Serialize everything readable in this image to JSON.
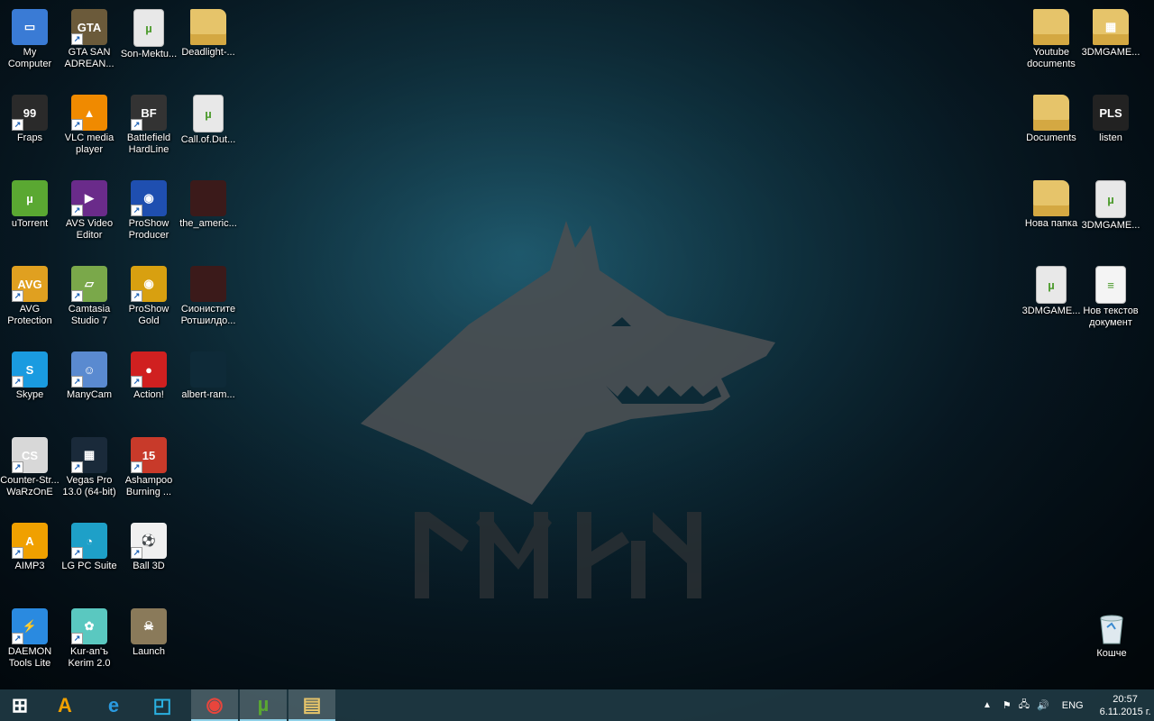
{
  "desktop_left": [
    {
      "label": "My Computer",
      "icon": "computer-icon",
      "color": "#3a7bd5",
      "glyph": "▭",
      "shortcut": false,
      "col": 0,
      "row": 0
    },
    {
      "label": "GTA SAN ADREAN...",
      "icon": "gta-icon",
      "color": "#6b5a3a",
      "glyph": "GTA",
      "shortcut": true,
      "col": 1,
      "row": 0
    },
    {
      "label": "Son-Mektu...",
      "icon": "torrent-file-icon",
      "color": "#e8e8e8",
      "glyph": "µ",
      "shortcut": false,
      "col": 2,
      "row": 0
    },
    {
      "label": "Deadlight-...",
      "icon": "folder-icon",
      "color": "#e6c46a",
      "glyph": "",
      "shortcut": false,
      "col": 3,
      "row": 0
    },
    {
      "label": "Fraps",
      "icon": "fraps-icon",
      "color": "#2a2a2a",
      "glyph": "99",
      "shortcut": true,
      "col": 0,
      "row": 1
    },
    {
      "label": "VLC media player",
      "icon": "vlc-icon",
      "color": "#f08a00",
      "glyph": "▲",
      "shortcut": true,
      "col": 1,
      "row": 1
    },
    {
      "label": "Battlefield HardLine",
      "icon": "battlefield-icon",
      "color": "#333",
      "glyph": "BF",
      "shortcut": true,
      "col": 2,
      "row": 1
    },
    {
      "label": "Call.of.Dut...",
      "icon": "torrent-file-icon",
      "color": "#e8e8e8",
      "glyph": "µ",
      "shortcut": false,
      "col": 3,
      "row": 1
    },
    {
      "label": "uTorrent",
      "icon": "utorrent-icon",
      "color": "#5aa832",
      "glyph": "µ",
      "shortcut": false,
      "col": 0,
      "row": 2
    },
    {
      "label": "AVS Video Editor",
      "icon": "avs-icon",
      "color": "#6a2b8a",
      "glyph": "▶",
      "shortcut": true,
      "col": 1,
      "row": 2
    },
    {
      "label": "ProShow Producer",
      "icon": "proshow-icon",
      "color": "#1f4fb0",
      "glyph": "◉",
      "shortcut": true,
      "col": 2,
      "row": 2
    },
    {
      "label": "the_americ...",
      "icon": "image-thumb-icon",
      "color": "#3b1a1a",
      "glyph": "",
      "shortcut": false,
      "col": 3,
      "row": 2
    },
    {
      "label": "AVG Protection",
      "icon": "avg-icon",
      "color": "#e0a020",
      "glyph": "AVG",
      "shortcut": true,
      "col": 0,
      "row": 3
    },
    {
      "label": "Camtasia Studio 7",
      "icon": "camtasia-icon",
      "color": "#7aa84a",
      "glyph": "▱",
      "shortcut": true,
      "col": 1,
      "row": 3
    },
    {
      "label": "ProShow Gold",
      "icon": "proshow-gold-icon",
      "color": "#d8a010",
      "glyph": "◉",
      "shortcut": true,
      "col": 2,
      "row": 3
    },
    {
      "label": "Сионистите Ротшилдо...",
      "icon": "image-thumb-icon",
      "color": "#3b1a1a",
      "glyph": "",
      "shortcut": false,
      "col": 3,
      "row": 3
    },
    {
      "label": "Skype",
      "icon": "skype-icon",
      "color": "#1a9be0",
      "glyph": "S",
      "shortcut": true,
      "col": 0,
      "row": 4
    },
    {
      "label": "ManyCam",
      "icon": "manycam-icon",
      "color": "#5a8ad0",
      "glyph": "☺",
      "shortcut": true,
      "col": 1,
      "row": 4
    },
    {
      "label": "Action!",
      "icon": "action-icon",
      "color": "#d02020",
      "glyph": "●",
      "shortcut": true,
      "col": 2,
      "row": 4
    },
    {
      "label": "albert-ram...",
      "icon": "image-thumb-icon",
      "color": "#0e2a38",
      "glyph": "",
      "shortcut": false,
      "col": 3,
      "row": 4
    },
    {
      "label": "Counter-Str... WaRzOnE",
      "icon": "counter-strike-icon",
      "color": "#d8d8d8",
      "glyph": "CS",
      "shortcut": true,
      "col": 0,
      "row": 5
    },
    {
      "label": "Vegas Pro 13.0 (64-bit)",
      "icon": "vegas-icon",
      "color": "#1a2a3a",
      "glyph": "▦",
      "shortcut": true,
      "col": 1,
      "row": 5
    },
    {
      "label": "Ashampoo Burning ...",
      "icon": "ashampoo-icon",
      "color": "#c83a2a",
      "glyph": "15",
      "shortcut": true,
      "col": 2,
      "row": 5
    },
    {
      "label": "AIMP3",
      "icon": "aimp-icon",
      "color": "#f0a000",
      "glyph": "A",
      "shortcut": true,
      "col": 0,
      "row": 6
    },
    {
      "label": "LG PC Suite",
      "icon": "lg-pc-suite-icon",
      "color": "#1ea0c8",
      "glyph": "◔",
      "shortcut": true,
      "col": 1,
      "row": 6
    },
    {
      "label": "Ball 3D",
      "icon": "ball-icon",
      "color": "#f0f0f0",
      "glyph": "⚽",
      "shortcut": true,
      "col": 2,
      "row": 6
    },
    {
      "label": "DAEMON Tools Lite",
      "icon": "daemon-tools-icon",
      "color": "#2a8ae0",
      "glyph": "⚡",
      "shortcut": true,
      "col": 0,
      "row": 7
    },
    {
      "label": "Kur-an'ъ Kerim 2.0",
      "icon": "kuran-icon",
      "color": "#5ac8c0",
      "glyph": "✿",
      "shortcut": true,
      "col": 1,
      "row": 7
    },
    {
      "label": "Launch",
      "icon": "launch-icon",
      "color": "#8a7a5a",
      "glyph": "☠",
      "shortcut": false,
      "col": 2,
      "row": 7
    }
  ],
  "desktop_right": [
    {
      "label": "Youtube documents",
      "icon": "folder-icon",
      "color": "#e6c46a",
      "glyph": "",
      "col": 0,
      "row": 0
    },
    {
      "label": "3DMGAME...",
      "icon": "folder-grid-icon",
      "color": "#e6c46a",
      "glyph": "▦",
      "col": 1,
      "row": 0
    },
    {
      "label": "Documents",
      "icon": "folder-icon",
      "color": "#e6c46a",
      "glyph": "",
      "col": 0,
      "row": 1
    },
    {
      "label": "listen",
      "icon": "pls-icon",
      "color": "#222",
      "glyph": "PLS",
      "col": 1,
      "row": 1
    },
    {
      "label": "Нова папка",
      "icon": "folder-icon",
      "color": "#e6c46a",
      "glyph": "",
      "col": 0,
      "row": 2
    },
    {
      "label": "3DMGAME...",
      "icon": "torrent-file-icon",
      "color": "#e8e8e8",
      "glyph": "µ",
      "col": 1,
      "row": 2
    },
    {
      "label": "3DMGAME...",
      "icon": "torrent-file-icon",
      "color": "#e8e8e8",
      "glyph": "µ",
      "col": 0,
      "row": 3
    },
    {
      "label": "Нов текстов документ",
      "icon": "text-file-icon",
      "color": "#f4f4f4",
      "glyph": "≡",
      "col": 1,
      "row": 3
    }
  ],
  "recycle_bin": {
    "label": "Кошче",
    "icon": "recycle-bin-icon"
  },
  "wallpaper": {
    "runes": "ᛚᛉᛋᚳ"
  },
  "taskbar": {
    "items": [
      {
        "name": "start-icon",
        "glyph": "⊞",
        "active": false,
        "color": "#ffffff"
      },
      {
        "name": "aimp-taskbar-icon",
        "glyph": "A",
        "active": false,
        "color": "#f0a000"
      },
      {
        "name": "internet-explorer-icon",
        "glyph": "e",
        "active": false,
        "color": "#2a9ae0"
      },
      {
        "name": "desktop-window-icon",
        "glyph": "◰",
        "active": false,
        "color": "#2ab0e0"
      },
      {
        "name": "chrome-icon",
        "glyph": "◉",
        "active": true,
        "color": "#e8453c"
      },
      {
        "name": "utorrent-taskbar-icon",
        "glyph": "µ",
        "active": true,
        "color": "#5aa832"
      },
      {
        "name": "file-explorer-icon",
        "glyph": "▤",
        "active": true,
        "color": "#e6c46a"
      }
    ],
    "language": "ENG",
    "time": "20:57",
    "date": "6.11.2015 г."
  }
}
